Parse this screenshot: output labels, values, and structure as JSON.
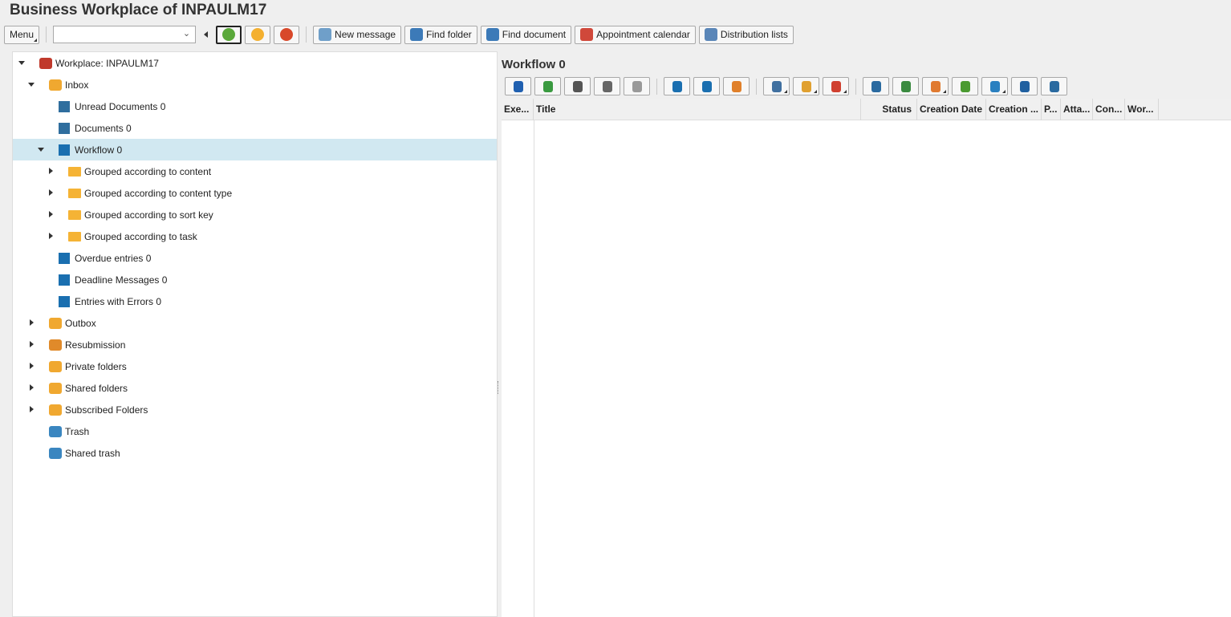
{
  "window": {
    "title": "Business Workplace of INPAULM17"
  },
  "toolbar": {
    "menu": "Menu",
    "combo_value": "",
    "new_message": "New message",
    "find_folder": "Find folder",
    "find_document": "Find document",
    "appointment_calendar": "Appointment calendar",
    "distribution_lists": "Distribution lists"
  },
  "tree": [
    {
      "label": "Workplace: INPAULM17",
      "level": 0,
      "toggle": "open",
      "icon": "workplace-icon"
    },
    {
      "label": "Inbox",
      "level": 1,
      "toggle": "open",
      "icon": "inbox-icon"
    },
    {
      "label": "Unread Documents 0",
      "level": 2,
      "toggle": "",
      "icon": "document-list-icon"
    },
    {
      "label": "Documents 0",
      "level": 2,
      "toggle": "",
      "icon": "document-list-icon"
    },
    {
      "label": "Workflow 0",
      "level": 2,
      "toggle": "open",
      "icon": "workflow-icon",
      "selected": true
    },
    {
      "label": "Grouped according to content",
      "level": 3,
      "toggle": "closed",
      "icon": "folder-icon"
    },
    {
      "label": "Grouped according to content type",
      "level": 3,
      "toggle": "closed",
      "icon": "folder-icon"
    },
    {
      "label": "Grouped according to sort key",
      "level": 3,
      "toggle": "closed",
      "icon": "folder-icon"
    },
    {
      "label": "Grouped according to task",
      "level": 3,
      "toggle": "closed",
      "icon": "folder-icon"
    },
    {
      "label": "Overdue entries 0",
      "level": 2,
      "toggle": "",
      "icon": "workflow-icon"
    },
    {
      "label": "Deadline Messages 0",
      "level": 2,
      "toggle": "",
      "icon": "workflow-icon"
    },
    {
      "label": "Entries with Errors 0",
      "level": 2,
      "toggle": "",
      "icon": "workflow-icon"
    },
    {
      "label": "Outbox",
      "level": 1,
      "toggle": "closed",
      "icon": "outbox-icon"
    },
    {
      "label": "Resubmission",
      "level": 1,
      "toggle": "closed",
      "icon": "resubmission-icon"
    },
    {
      "label": "Private folders",
      "level": 1,
      "toggle": "closed",
      "icon": "private-folders-icon"
    },
    {
      "label": "Shared folders",
      "level": 1,
      "toggle": "closed",
      "icon": "shared-folders-icon"
    },
    {
      "label": "Subscribed Folders",
      "level": 1,
      "toggle": "closed",
      "icon": "subscribed-folders-icon"
    },
    {
      "label": "Trash",
      "level": 1,
      "toggle": "",
      "icon": "trash-icon"
    },
    {
      "label": "Shared trash",
      "level": 1,
      "toggle": "",
      "icon": "trash-icon"
    }
  ],
  "right": {
    "title": "Workflow 0",
    "columns": [
      "Exe...",
      "Title",
      "Status",
      "Creation Date",
      "Creation ...",
      "P...",
      "Atta...",
      "Con...",
      "Wor..."
    ]
  },
  "colors": {
    "selected_row": "#d1e8f1",
    "folder": "#f5b335",
    "blue_icon": "#1a6fb0"
  }
}
